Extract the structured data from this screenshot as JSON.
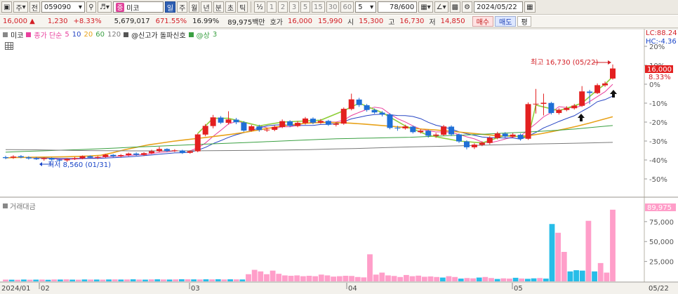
{
  "toolbar": {
    "menu_label": "주",
    "market_label": "전",
    "stock_code": "059090",
    "stock_name": "미코",
    "stock_badge": "중",
    "periods": [
      "일",
      "주",
      "월",
      "년",
      "분",
      "초",
      "틱"
    ],
    "active_period": "일",
    "fraction": "½",
    "intervals": [
      "1",
      "2",
      "3",
      "5",
      "15",
      "30",
      "60"
    ],
    "interval_select": "5",
    "view_count": "78/600",
    "date": "2024/05/22"
  },
  "quote": {
    "price": "16,000",
    "change": "1,230",
    "change_pct": "+8.33%",
    "volume": "5,679,017",
    "volume_ratio": "671.55%",
    "turnover_pct": "16.99%",
    "trade_value": "89,975백만",
    "ask_label": "호가",
    "ask": "16,000",
    "bid": "15,990",
    "open_label": "시",
    "open": "15,300",
    "high_label": "고",
    "high": "16,730",
    "low_label": "저",
    "low": "14,850",
    "buy_label": "매수",
    "sell_label": "매도",
    "eval_label": "평"
  },
  "legend": {
    "chart_label": "미코",
    "ma_label": "종가 단순",
    "ma_periods": [
      "5",
      "10",
      "20",
      "60",
      "120"
    ],
    "signal_label": "@신고가 돌파신호",
    "sang_label": "@상",
    "sang_value": "3"
  },
  "colors": {
    "up": "#e32020",
    "down": "#1f6fd6",
    "ma5": "#e8409d",
    "ma10": "#2645c4",
    "ma20": "#e8a21a",
    "ma60": "#3aa042",
    "ma120": "#7a7a7a",
    "volume": "#ff9ec9",
    "volume_down": "#27bde8"
  },
  "chart_data": {
    "type": "candlestick",
    "x_axis_labels": [
      "2024/01",
      "02",
      "03",
      "04",
      "05",
      "05/22"
    ],
    "y_axis_labels": [
      "20%",
      "10%",
      "0%",
      "-10%",
      "-20%",
      "-30%",
      "-40%",
      "-50%"
    ],
    "ylim_pct": [
      -55,
      22
    ],
    "right_labels": {
      "lc": "LC:88.24",
      "hc": "HC:-4.36",
      "price_tag": "16,000",
      "pct_tag": "8.33%"
    },
    "annotations": {
      "high": "최고 16,730 (05/22)",
      "low": "최저 8,560 (01/31)"
    },
    "candles": [
      [
        -38.5,
        -39.0,
        -37.8,
        -39.6
      ],
      [
        -38.8,
        -38.2,
        -37.5,
        -39.4
      ],
      [
        -38.0,
        -38.6,
        -37.4,
        -39.1
      ],
      [
        -38.6,
        -39.2,
        -38.0,
        -39.8
      ],
      [
        -39.2,
        -39.6,
        -38.4,
        -40.0
      ],
      [
        -39.5,
        -39.0,
        -38.6,
        -40.4
      ],
      [
        -39.0,
        -39.8,
        -38.7,
        -40.6
      ],
      [
        -39.8,
        -40.3,
        -39.2,
        -40.8
      ],
      [
        -40.2,
        -39.4,
        -39.0,
        -41.0
      ],
      [
        -39.4,
        -39.0,
        -38.4,
        -40.0
      ],
      [
        -39.1,
        -38.0,
        -37.6,
        -39.6
      ],
      [
        -38.0,
        -38.8,
        -37.6,
        -39.3
      ],
      [
        -38.8,
        -38.4,
        -37.9,
        -39.5
      ],
      [
        -38.4,
        -37.2,
        -36.8,
        -38.9
      ],
      [
        -37.3,
        -38.1,
        -36.9,
        -38.6
      ],
      [
        -38.0,
        -37.4,
        -36.9,
        -38.6
      ],
      [
        -37.4,
        -36.6,
        -36.1,
        -38.0
      ],
      [
        -36.6,
        -37.3,
        -36.0,
        -37.8
      ],
      [
        -37.3,
        -36.4,
        -35.9,
        -37.9
      ],
      [
        -36.4,
        -35.4,
        -34.6,
        -36.9
      ],
      [
        -35.4,
        -34.2,
        -33.0,
        -35.9
      ],
      [
        -34.2,
        -35.2,
        -33.8,
        -35.8
      ],
      [
        -35.2,
        -34.9,
        -34.3,
        -35.8
      ],
      [
        -35.0,
        -36.3,
        -34.6,
        -36.8
      ],
      [
        -36.2,
        -35.4,
        -34.9,
        -36.7
      ],
      [
        -35.4,
        -26.5,
        -26.0,
        -35.9
      ],
      [
        -26.6,
        -22.0,
        -21.0,
        -27.5
      ],
      [
        -22.1,
        -17.5,
        -16.2,
        -23.3
      ],
      [
        -17.6,
        -20.3,
        -16.8,
        -21.0
      ],
      [
        -20.4,
        -18.6,
        -14.3,
        -21.3
      ],
      [
        -18.7,
        -20.1,
        -17.8,
        -21.1
      ],
      [
        -20.2,
        -24.5,
        -19.5,
        -25.1
      ],
      [
        -24.4,
        -22.2,
        -21.5,
        -25.0
      ],
      [
        -22.3,
        -24.2,
        -21.4,
        -25.1
      ],
      [
        -24.2,
        -24.0,
        -23.1,
        -25.2
      ],
      [
        -24.1,
        -22.5,
        -21.8,
        -24.8
      ],
      [
        -22.6,
        -19.5,
        -18.6,
        -23.2
      ],
      [
        -19.6,
        -22.0,
        -19.0,
        -22.7
      ],
      [
        -22.1,
        -20.4,
        -19.5,
        -22.7
      ],
      [
        -20.5,
        -18.1,
        -17.3,
        -21.3
      ],
      [
        -18.2,
        -20.3,
        -17.5,
        -21.1
      ],
      [
        -20.3,
        -19.4,
        -18.4,
        -20.9
      ],
      [
        -19.4,
        -21.4,
        -18.8,
        -22.0
      ],
      [
        -21.4,
        -20.8,
        -19.9,
        -22.3
      ],
      [
        -20.8,
        -13.0,
        -12.3,
        -21.4
      ],
      [
        -13.1,
        -8.0,
        -5.0,
        -13.8
      ],
      [
        -8.1,
        -11.0,
        -7.2,
        -12.0
      ],
      [
        -11.1,
        -13.6,
        -10.4,
        -14.5
      ],
      [
        -13.6,
        -14.9,
        -12.8,
        -15.6
      ],
      [
        -15.0,
        -16.0,
        -14.2,
        -17.0
      ],
      [
        -16.0,
        -23.1,
        -15.3,
        -23.8
      ],
      [
        -23.0,
        -23.3,
        -22.0,
        -24.6
      ],
      [
        -23.3,
        -22.3,
        -21.4,
        -24.0
      ],
      [
        -22.4,
        -25.3,
        -21.8,
        -26.0
      ],
      [
        -25.3,
        -24.5,
        -23.7,
        -26.0
      ],
      [
        -24.6,
        -27.2,
        -24.0,
        -28.2
      ],
      [
        -27.2,
        -26.6,
        -25.7,
        -28.3
      ],
      [
        -26.7,
        -22.3,
        -21.5,
        -27.3
      ],
      [
        -22.4,
        -26.5,
        -21.7,
        -27.3
      ],
      [
        -26.5,
        -30.2,
        -26.0,
        -31.0
      ],
      [
        -30.2,
        -33.3,
        -29.6,
        -34.4
      ],
      [
        -33.3,
        -31.9,
        -31.2,
        -34.2
      ],
      [
        -32.0,
        -30.9,
        -30.2,
        -32.7
      ],
      [
        -31.0,
        -28.3,
        -27.5,
        -31.8
      ],
      [
        -28.4,
        -26.0,
        -25.1,
        -29.1
      ],
      [
        -26.1,
        -27.6,
        -25.3,
        -28.6
      ],
      [
        -27.6,
        -26.6,
        -25.8,
        -28.3
      ],
      [
        -26.7,
        -28.9,
        -26.0,
        -29.8
      ],
      [
        -28.8,
        -10.5,
        -9.6,
        -29.4
      ],
      [
        -10.6,
        -10.3,
        -2.5,
        -15.5
      ],
      [
        -10.4,
        -9.8,
        -5.0,
        -16.5
      ],
      [
        -9.9,
        -15.2,
        -9.3,
        -16.0
      ],
      [
        -15.2,
        -13.5,
        -12.7,
        -16.0
      ],
      [
        -13.6,
        -12.6,
        -11.6,
        -14.3
      ],
      [
        -12.7,
        -11.3,
        -10.4,
        -13.4
      ],
      [
        -11.4,
        -3.8,
        -1.0,
        -12.0
      ],
      [
        -3.9,
        -4.6,
        -3.0,
        -10.5
      ],
      [
        -4.7,
        -0.5,
        0.4,
        -5.2
      ],
      [
        -0.6,
        0.4,
        1.4,
        -1.4
      ],
      [
        3.0,
        8.3,
        10.4,
        2.4
      ]
    ],
    "ma20": [
      -38.9,
      -38.7,
      -38.6,
      -38.5,
      -38.4,
      -38.3,
      -38.1,
      -37.9,
      -37.5,
      -36.2,
      -34.6,
      -33.3,
      -32.0,
      -31.1,
      -30.2,
      -29.4,
      -28.7,
      -28.0,
      -27.2,
      -26.4,
      -25.5,
      -24.4,
      -23.3,
      -22.3,
      -21.4,
      -20.7,
      -20.3,
      -20.2,
      -20.3,
      -20.6,
      -21.0,
      -21.5,
      -22.0,
      -22.5,
      -23.1,
      -23.7,
      -24.1,
      -24.6,
      -25.2,
      -25.8,
      -26.4,
      -27.0,
      -27.4,
      -27.5,
      -27.1,
      -26.1,
      -24.9,
      -23.6,
      -22.2,
      -20.6,
      -18.9,
      -17.2
    ],
    "ma60": [
      -35.9,
      -35.5,
      -35.2,
      -34.8,
      -34.5,
      -34.1,
      -33.7,
      -33.2,
      -32.8,
      -32.4,
      -32.0,
      -31.6,
      -31.2,
      -30.8,
      -30.4,
      -30.0,
      -29.6,
      -29.2,
      -28.8,
      -28.6,
      -28.4,
      -28.2,
      -28.0,
      -27.6,
      -27.2,
      -26.8,
      -26.4,
      -25.9,
      -25.4,
      -24.9,
      -24.3,
      -23.6,
      -22.7,
      -21.8
    ],
    "ma120": [
      -34.5,
      -34.6,
      -34.8,
      -35.0,
      -35.1,
      -35.2,
      -35.2,
      -35.2,
      -35.1,
      -35.0,
      -34.9,
      -34.7,
      -34.5,
      -34.2,
      -33.9,
      -33.5,
      -33.1,
      -32.8,
      -32.5,
      -32.1,
      -31.8,
      -31.5,
      -31.3,
      -31.0,
      -30.7
    ],
    "volume": {
      "right_labels": [
        "89,975",
        "75,000",
        "50,000",
        "25,000",
        "25,000"
      ],
      "ylim": [
        0,
        96000
      ],
      "values": [
        2200,
        2100,
        2000,
        2300,
        2100,
        2200,
        2300,
        2000,
        2400,
        2300,
        2500,
        2200,
        2100,
        2400,
        2300,
        2300,
        2200,
        2400,
        2500,
        2300,
        2400,
        2600,
        2300,
        2200,
        2500,
        2600,
        2400,
        2300,
        2500,
        2700,
        2600,
        2500,
        2400,
        2600,
        2500,
        2700,
        2400,
        2600,
        2500,
        2400,
        9000,
        14500,
        12500,
        9000,
        13500,
        9500,
        7500,
        7000,
        7500,
        6500,
        7000,
        6500,
        8500,
        7500,
        6000,
        6500,
        7000,
        6800,
        5500,
        5000,
        34000,
        8500,
        11000,
        7500,
        6800,
        5500,
        8000,
        6500,
        7200,
        5800,
        6200,
        5500,
        4800,
        6500,
        5500,
        3500,
        4200,
        3800,
        4800,
        5500,
        4200,
        3000,
        3800,
        3500,
        4500,
        3600,
        3200,
        3800,
        4200,
        3500,
        72000,
        61000,
        37000,
        12500,
        14000,
        13500,
        76000,
        12500,
        23000,
        11000,
        89975
      ]
    }
  }
}
